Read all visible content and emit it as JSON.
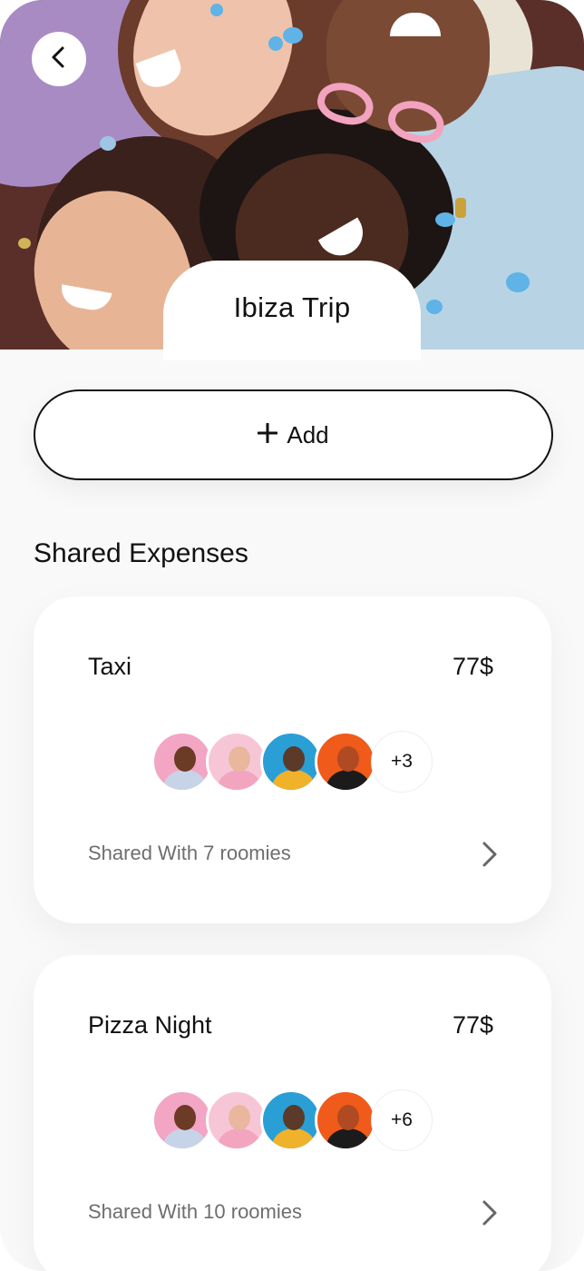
{
  "header": {
    "title": "Ibiza Trip",
    "back_icon": "chevron-left-icon"
  },
  "actions": {
    "add_label": "Add",
    "add_icon": "plus-icon"
  },
  "section": {
    "title": "Shared Expenses"
  },
  "expenses": [
    {
      "name": "Taxi",
      "amount": "77$",
      "more_count": "+3",
      "shared_text": "Shared With 7 roomies",
      "avatars": [
        "avatar-pink-woman",
        "avatar-pink-sweater",
        "avatar-blue-man",
        "avatar-orange-man"
      ]
    },
    {
      "name": "Pizza Night",
      "amount": "77$",
      "more_count": "+6",
      "shared_text": "Shared With 10 roomies",
      "avatars": [
        "avatar-pink-woman",
        "avatar-pink-sweater",
        "avatar-blue-man",
        "avatar-orange-man"
      ]
    }
  ],
  "colors": {
    "background": "#f9f9f9",
    "card": "#ffffff",
    "text": "#111111",
    "muted": "#6e6e6e"
  }
}
